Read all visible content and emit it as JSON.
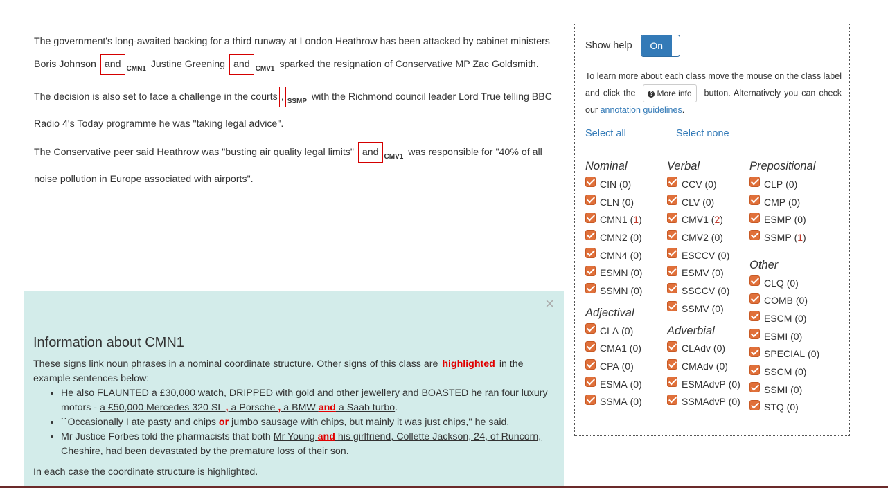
{
  "text": {
    "p1": {
      "a": "The government's long-awaited backing for a third runway at London Heathrow has been attacked by cabinet ministers Boris Johnson ",
      "s1": "and",
      "s1_tag": "CMN1",
      "b": " Justine Greening ",
      "s2": "and",
      "s2_tag": "CMV1",
      "c": " sparked the resignation of Conservative MP Zac Goldsmith."
    },
    "p2": {
      "a": "The decision is also set to face a challenge in the courts",
      "s1": ",",
      "s1_tag": "SSMP",
      "b": " with the Richmond council leader Lord True telling BBC Radio 4's Today programme he was \"taking legal advice\"."
    },
    "p3": {
      "a": "The Conservative peer said Heathrow was \"busting air quality legal limits\" ",
      "s1": "and",
      "s1_tag": "CMV1",
      "b": " was responsible for \"40% of all noise pollution in Europe associated with airports\"."
    }
  },
  "help": {
    "show_label": "Show help",
    "toggle": "On",
    "text_a": "To learn more about each class move the mouse on the class label and click the",
    "button": "More info",
    "text_b": "button. Alternatively you can check our",
    "link": "annotation guidelines",
    "text_c": "."
  },
  "select_all": "Select all",
  "select_none": "Select none",
  "groups": {
    "nominal": {
      "title": "Nominal",
      "items": [
        {
          "label": "CIN",
          "count": "(0)"
        },
        {
          "label": "CLN",
          "count": "(0)"
        },
        {
          "label": "CMN1",
          "count_open": "(",
          "count_num": "1",
          "count_close": ")"
        },
        {
          "label": "CMN2",
          "count": "(0)"
        },
        {
          "label": "CMN4",
          "count": "(0)"
        },
        {
          "label": "ESMN",
          "count": "(0)"
        },
        {
          "label": "SSMN",
          "count": "(0)"
        }
      ]
    },
    "adjectival": {
      "title": "Adjectival",
      "items": [
        {
          "label": "CLA",
          "count": "(0)"
        },
        {
          "label": "CMA1",
          "count": "(0)"
        },
        {
          "label": "CPA",
          "count": "(0)"
        },
        {
          "label": "ESMA",
          "count": "(0)"
        },
        {
          "label": "SSMA",
          "count": "(0)"
        }
      ]
    },
    "verbal": {
      "title": "Verbal",
      "items": [
        {
          "label": "CCV",
          "count": "(0)"
        },
        {
          "label": "CLV",
          "count": "(0)"
        },
        {
          "label": "CMV1",
          "count_open": "(",
          "count_num": "2",
          "count_close": ")"
        },
        {
          "label": "CMV2",
          "count": "(0)"
        },
        {
          "label": "ESCCV",
          "count": "(0)"
        },
        {
          "label": "ESMV",
          "count": "(0)"
        },
        {
          "label": "SSCCV",
          "count": "(0)"
        },
        {
          "label": "SSMV",
          "count": "(0)"
        }
      ]
    },
    "adverbial": {
      "title": "Adverbial",
      "items": [
        {
          "label": "CLAdv",
          "count": "(0)"
        },
        {
          "label": "CMAdv",
          "count": "(0)"
        },
        {
          "label": "ESMAdvP",
          "count": "(0)"
        },
        {
          "label": "SSMAdvP",
          "count": "(0)"
        }
      ]
    },
    "prepositional": {
      "title": "Prepositional",
      "items": [
        {
          "label": "CLP",
          "count": "(0)"
        },
        {
          "label": "CMP",
          "count": "(0)"
        },
        {
          "label": "ESMP",
          "count": "(0)"
        },
        {
          "label": "SSMP",
          "count_open": "(",
          "count_num": "1",
          "count_close": ")"
        }
      ]
    },
    "other": {
      "title": "Other",
      "items": [
        {
          "label": "CLQ",
          "count": "(0)"
        },
        {
          "label": "COMB",
          "count": "(0)"
        },
        {
          "label": "ESCM",
          "count": "(0)"
        },
        {
          "label": "ESMI",
          "count": "(0)"
        },
        {
          "label": "SPECIAL",
          "count": "(0)"
        },
        {
          "label": "SSCM",
          "count": "(0)"
        },
        {
          "label": "SSMI",
          "count": "(0)"
        },
        {
          "label": "STQ",
          "count": "(0)"
        }
      ]
    }
  },
  "info": {
    "close": "×",
    "title": "Information about CMN1",
    "intro_a": "These signs link noun phrases in a nominal coordinate structure. Other signs of this class are",
    "intro_hl": "highlighted",
    "intro_b": "in the example sentences below:",
    "ex1": {
      "a": "He also FLAUNTED a £30,000 watch, DRIPPED with gold and other jewellery and BOASTED he ran four luxury motors - ",
      "c1": "a £50,000 Mercedes 320 SL ",
      "s1": ",",
      "c2": " a Porsche ",
      "s2": ",",
      "c3": " a BMW ",
      "s3": "and",
      "c4": " a Saab turbo",
      "d": "."
    },
    "ex2": {
      "a": "``Occasionally I ate ",
      "c1": "pasty and chips ",
      "s1": "or",
      "c2": " jumbo sausage with chips",
      "b": ", but mainly it was just chips,'' he said."
    },
    "ex3": {
      "a": "Mr Justice Forbes told the pharmacists that both ",
      "c1": "Mr Young ",
      "s1": "and",
      "c2": " his girlfriend, Collette Jackson, 24, of Runcorn, Cheshire",
      "b": ", had been devastated by the premature loss of their son."
    },
    "foot_a": "In each case the coordinate structure is ",
    "foot_hl": "highlighted",
    "foot_b": "."
  },
  "colors": {
    "accent": "#337ab7",
    "checkbox": "#e0703a",
    "sign_border": "#d40000",
    "info_bg": "#d3ecea"
  }
}
